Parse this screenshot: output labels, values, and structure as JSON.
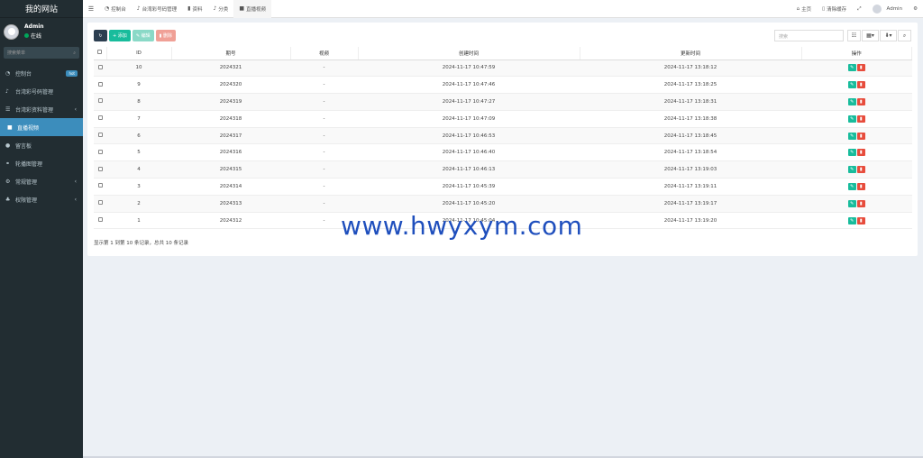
{
  "sidebar": {
    "logo": "我的网站",
    "user": {
      "name": "Admin",
      "status": "在线"
    },
    "search_placeholder": "搜索菜单",
    "items": [
      {
        "label": "控制台",
        "icon": "dashboard-icon",
        "badge": "hot"
      },
      {
        "label": "台湾彩号码管理",
        "icon": "bell-icon"
      },
      {
        "label": "台湾彩资料管理",
        "icon": "list-icon",
        "chevron": "‹"
      },
      {
        "label": "直播视频",
        "icon": "video-icon",
        "active": true
      },
      {
        "label": "留言板",
        "icon": "comment-icon"
      },
      {
        "label": "轮播图管理",
        "icon": "link-icon"
      },
      {
        "label": "常规管理",
        "icon": "cogs-icon",
        "chevron": "‹"
      },
      {
        "label": "权限管理",
        "icon": "group-icon",
        "chevron": "‹"
      }
    ]
  },
  "topbar": {
    "tabs": [
      {
        "label": "控制台",
        "icon": "dashboard-icon"
      },
      {
        "label": "台湾彩号码管理",
        "icon": "bell-icon"
      },
      {
        "label": "资料",
        "icon": "bookmark-icon"
      },
      {
        "label": "分类",
        "icon": "bell-icon"
      },
      {
        "label": "直播视频",
        "icon": "video-icon",
        "active": true
      }
    ],
    "right": {
      "home": "主页",
      "clear_cache": "清除缓存",
      "user": "Admin"
    }
  },
  "toolbar": {
    "add": "添加",
    "edit": "编辑",
    "delete": "删除",
    "search_placeholder": "搜索"
  },
  "table": {
    "headers": [
      "ID",
      "期号",
      "视频",
      "创建时间",
      "更新时间",
      "操作"
    ],
    "rows": [
      [
        "10",
        "2024321",
        "-",
        "2024-11-17 10:47:59",
        "2024-11-17 13:18:12"
      ],
      [
        "9",
        "2024320",
        "-",
        "2024-11-17 10:47:46",
        "2024-11-17 13:18:25"
      ],
      [
        "8",
        "2024319",
        "-",
        "2024-11-17 10:47:27",
        "2024-11-17 13:18:31"
      ],
      [
        "7",
        "2024318",
        "-",
        "2024-11-17 10:47:09",
        "2024-11-17 13:18:38"
      ],
      [
        "6",
        "2024317",
        "-",
        "2024-11-17 10:46:53",
        "2024-11-17 13:18:45"
      ],
      [
        "5",
        "2024316",
        "-",
        "2024-11-17 10:46:40",
        "2024-11-17 13:18:54"
      ],
      [
        "4",
        "2024315",
        "-",
        "2024-11-17 10:46:13",
        "2024-11-17 13:19:03"
      ],
      [
        "3",
        "2024314",
        "-",
        "2024-11-17 10:45:39",
        "2024-11-17 13:19:11"
      ],
      [
        "2",
        "2024313",
        "-",
        "2024-11-17 10:45:20",
        "2024-11-17 13:19:17"
      ],
      [
        "1",
        "2024312",
        "-",
        "2024-11-17 10:45:04",
        "2024-11-17 13:19:20"
      ]
    ]
  },
  "pager": "显示第 1 到第 10 条记录，总共 10 条记录",
  "watermark": "www.hwyxym.com",
  "colors": {
    "sidebar_bg": "#222d32",
    "active": "#3c8dbc",
    "green": "#18bc9c",
    "red": "#e74c3c",
    "watermark": "#1f4fbd"
  }
}
